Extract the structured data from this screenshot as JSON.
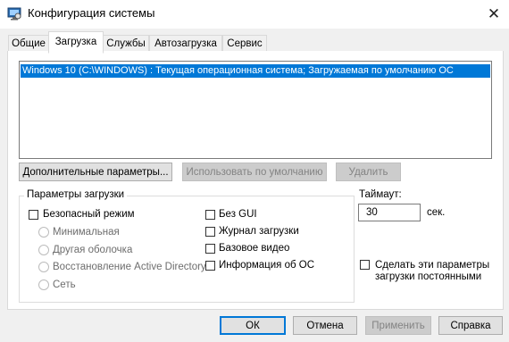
{
  "window": {
    "title": "Конфигурация системы",
    "close_glyph": "✕"
  },
  "tabs": [
    {
      "label": "Общие"
    },
    {
      "label": "Загрузка"
    },
    {
      "label": "Службы"
    },
    {
      "label": "Автозагрузка"
    },
    {
      "label": "Сервис"
    }
  ],
  "os_list": {
    "items": [
      "Windows 10 (C:\\WINDOWS) : Текущая операционная система; Загружаемая по умолчанию ОС"
    ]
  },
  "buttons": {
    "advanced": "Дополнительные параметры...",
    "set_default": "Использовать по умолчанию",
    "delete": "Удалить",
    "ok": "ОК",
    "cancel": "Отмена",
    "apply": "Применить",
    "help": "Справка"
  },
  "boot_options": {
    "legend": "Параметры загрузки",
    "safe_boot": "Безопасный режим",
    "minimal": "Минимальная",
    "alternate_shell": "Другая оболочка",
    "ad_repair": "Восстановление Active Directory",
    "network": "Сеть",
    "no_gui": "Без GUI",
    "boot_log": "Журнал загрузки",
    "base_video": "Базовое видео",
    "os_info": "Информация  об ОС"
  },
  "timeout": {
    "label": "Таймаут:",
    "value": "30",
    "unit": "сек."
  },
  "permanent": {
    "label_line1": "Сделать эти параметры",
    "label_line2": "загрузки постоянными"
  },
  "colors": {
    "accent": "#0078d7",
    "selection_text": "#ffffff"
  }
}
